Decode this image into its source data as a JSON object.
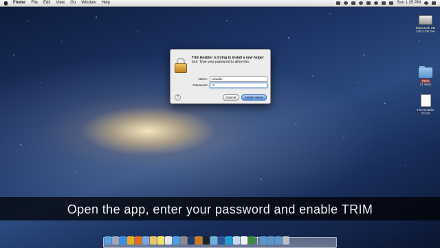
{
  "menubar": {
    "app_name": "Finder",
    "menus": [
      "File",
      "Edit",
      "View",
      "Go",
      "Window",
      "Help"
    ],
    "clock": "Sun 1:35 PM"
  },
  "desktop_icons": [
    {
      "label": "Macintosh HD",
      "sublabel": "249.2 GB free"
    },
    {
      "label": "11 items",
      "badge": "NEW"
    },
    {
      "label": "Trim Enabler",
      "sublabel": "22 KB"
    }
  ],
  "dialog": {
    "message_bold": "Trim Enabler is trying to install a new helper",
    "message_rest": "tool. Type your password to allow this.",
    "name_label": "Name:",
    "name_value": "Claudiu",
    "password_label": "Password:",
    "password_value": "•••",
    "help_label": "?",
    "cancel_label": "Cancel",
    "install_label": "Install Helper"
  },
  "caption": "Open the app, enter your password and enable TRIM",
  "dock": {
    "icons": [
      "finder",
      "launchpad",
      "safari",
      "chrome",
      "firefox",
      "mail",
      "photos",
      "notes",
      "calendar",
      "app-store",
      "system-prefs",
      "photoshop",
      "illustrator",
      "terminal",
      "itunes",
      "word",
      "skype",
      "preview",
      "textedit",
      "activity",
      "downloads",
      "documents",
      "folder",
      "trash"
    ],
    "colors": [
      "#5aa0e6",
      "#9aa6b8",
      "#3a8de0",
      "#e0b020",
      "#e86a20",
      "#7aa7d9",
      "#e9c46a",
      "#f4e36a",
      "#e8e8e8",
      "#4aa0e8",
      "#8a8a8a",
      "#1e3d6d",
      "#d07a1a",
      "#222222",
      "#6fb0e0",
      "#2b579a",
      "#19a0d8",
      "#c8d8f0",
      "#f2f2f2",
      "#3c8c3c",
      "#5d95cf",
      "#5d95cf",
      "#5d95cf",
      "#b8c0c8"
    ]
  }
}
